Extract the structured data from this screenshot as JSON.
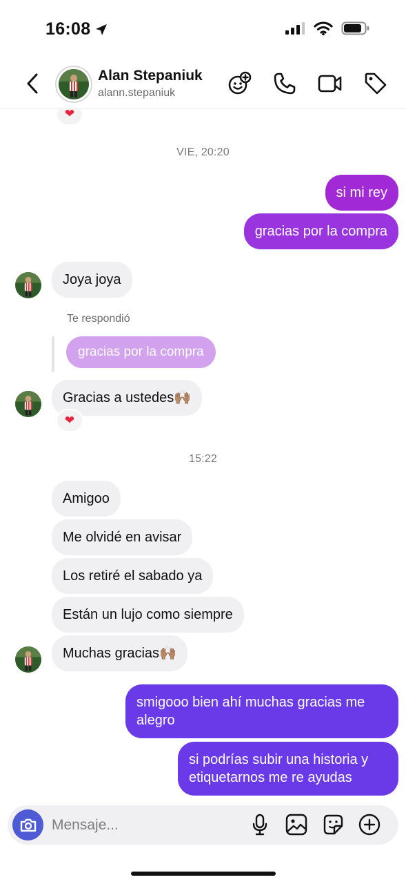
{
  "status_bar": {
    "time": "16:08"
  },
  "header": {
    "name": "Alan Stepaniuk",
    "username": "alann.stepaniuk"
  },
  "thread": {
    "timestamps": [
      "VIE, 20:20",
      "15:22"
    ],
    "reply_label": "Te respondió",
    "reply_quote": "gracias por la compra",
    "messages": [
      {
        "from": "me",
        "text": "si mi rey"
      },
      {
        "from": "me",
        "text": "gracias por la compra"
      },
      {
        "from": "them",
        "text": "Joya joya"
      },
      {
        "from": "them",
        "text": "Gracias a ustedes🙌🏽",
        "reaction": "❤"
      },
      {
        "from": "them",
        "text": "Amigoo"
      },
      {
        "from": "them",
        "text": "Me olvidé en avisar"
      },
      {
        "from": "them",
        "text": "Los retiré el sabado ya"
      },
      {
        "from": "them",
        "text": "Están un lujo como siempre"
      },
      {
        "from": "them",
        "text": "Muchas gracias🙌🏽"
      },
      {
        "from": "me",
        "text": "smigooo bien ahí muchas gracias me alegro"
      },
      {
        "from": "me",
        "text": "si podrías subir una historia y etiquetarnos me re ayudas"
      }
    ],
    "top_reaction": "❤"
  },
  "composer": {
    "placeholder": "Mensaje..."
  },
  "colors": {
    "outgoing_purple": "#a229d6",
    "outgoing_violet": "#6a3ae8",
    "incoming_gray": "#f0f0f2",
    "camera_blue": "#4f5bd5",
    "reaction_red": "#e8253c"
  },
  "icons": [
    "location-arrow-icon",
    "signal-icon",
    "wifi-icon",
    "battery-icon",
    "back-chevron-icon",
    "add-emoji-icon",
    "phone-icon",
    "video-icon",
    "tag-icon",
    "camera-icon",
    "microphone-icon",
    "gallery-icon",
    "sticker-icon",
    "plus-circle-icon"
  ]
}
